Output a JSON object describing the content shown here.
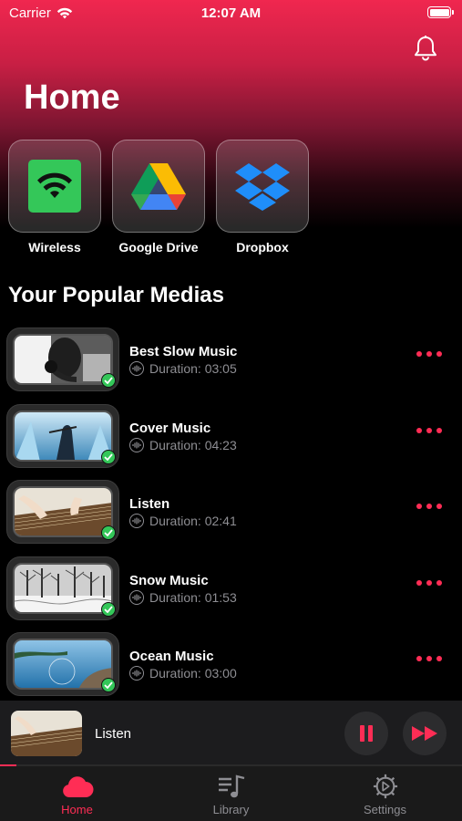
{
  "status_bar": {
    "carrier": "Carrier",
    "time": "12:07 AM",
    "wifi_icon": "wifi-icon",
    "battery_icon": "battery-icon"
  },
  "header": {
    "title": "Home",
    "notification_icon": "bell-icon"
  },
  "sources": [
    {
      "label": "Wireless",
      "icon": "wifi-icon"
    },
    {
      "label": "Google Drive",
      "icon": "google-drive-icon"
    },
    {
      "label": "Dropbox",
      "icon": "dropbox-icon"
    }
  ],
  "section_title": "Your Popular Medias",
  "medias": [
    {
      "title": "Best Slow Music",
      "duration": "Duration: 03:05",
      "thumb": "headphones-photo"
    },
    {
      "title": "Cover Music",
      "duration": "Duration: 04:23",
      "thumb": "violinist-ice-photo"
    },
    {
      "title": "Listen",
      "duration": "Duration: 02:41",
      "thumb": "guzheng-hands-photo"
    },
    {
      "title": "Snow Music",
      "duration": "Duration: 01:53",
      "thumb": "snowy-trees-photo"
    },
    {
      "title": "Ocean Music",
      "duration": "Duration: 03:00",
      "thumb": "ocean-coast-photo"
    }
  ],
  "now_playing": {
    "title": "Listen",
    "progress": 0.035,
    "pause_icon": "pause-icon",
    "next_icon": "fast-forward-icon"
  },
  "tabs": [
    {
      "label": "Home",
      "icon": "cloud-icon",
      "active": true
    },
    {
      "label": "Library",
      "icon": "music-library-icon",
      "active": false
    },
    {
      "label": "Settings",
      "icon": "gear-icon",
      "active": false
    }
  ],
  "colors": {
    "accent": "#ff2d55",
    "header_gradient_top": "#f0274f",
    "background": "#000000",
    "check": "#34c759",
    "wireless_tile": "#34c759",
    "dropbox": "#0061fe"
  }
}
